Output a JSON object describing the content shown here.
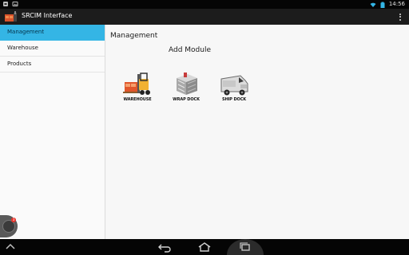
{
  "app": {
    "title": "SRCIM Interface"
  },
  "status_bar": {
    "time": "14:56"
  },
  "sidebar": {
    "items": [
      {
        "label": "Management",
        "active": true
      },
      {
        "label": "Warehouse",
        "active": false
      },
      {
        "label": "Products",
        "active": false
      }
    ]
  },
  "main": {
    "title": "Management",
    "section_title": "Add Module",
    "modules": [
      {
        "label": "WAREHOUSE",
        "icon": "forklift-icon"
      },
      {
        "label": "WRAP DOCK",
        "icon": "wrap-box-icon"
      },
      {
        "label": "SHIP DOCK",
        "icon": "van-icon"
      }
    ]
  },
  "fab": {
    "badge": "3"
  },
  "colors": {
    "accent": "#34b5e5",
    "action_bar": "#1c1c1c",
    "status_bar": "#050505"
  }
}
